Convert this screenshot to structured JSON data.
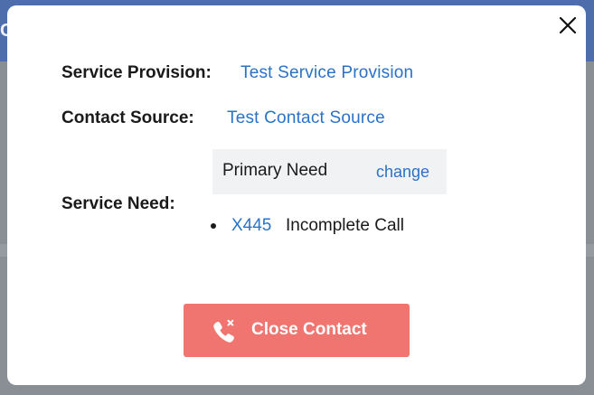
{
  "background": {
    "header_color": "#4d6dab",
    "header_text_fragment": "C"
  },
  "modal": {
    "close_icon": "close-icon",
    "service_provision": {
      "label": "Service Provision:",
      "value": "Test Service Provision"
    },
    "contact_source": {
      "label": "Contact Source:",
      "value": "Test Contact Source"
    },
    "service_need": {
      "label": "Service Need:",
      "primary_title": "Primary Need",
      "change_link": "change",
      "items": [
        {
          "code": "X445",
          "description": "Incomplete Call"
        }
      ]
    },
    "close_contact_button": {
      "label": "Close Contact",
      "icon": "phone-x-icon",
      "color": "#f07570"
    }
  },
  "colors": {
    "link": "#2a72c7",
    "text": "#1a1a1a",
    "need_box_bg": "#f1f2f4"
  }
}
